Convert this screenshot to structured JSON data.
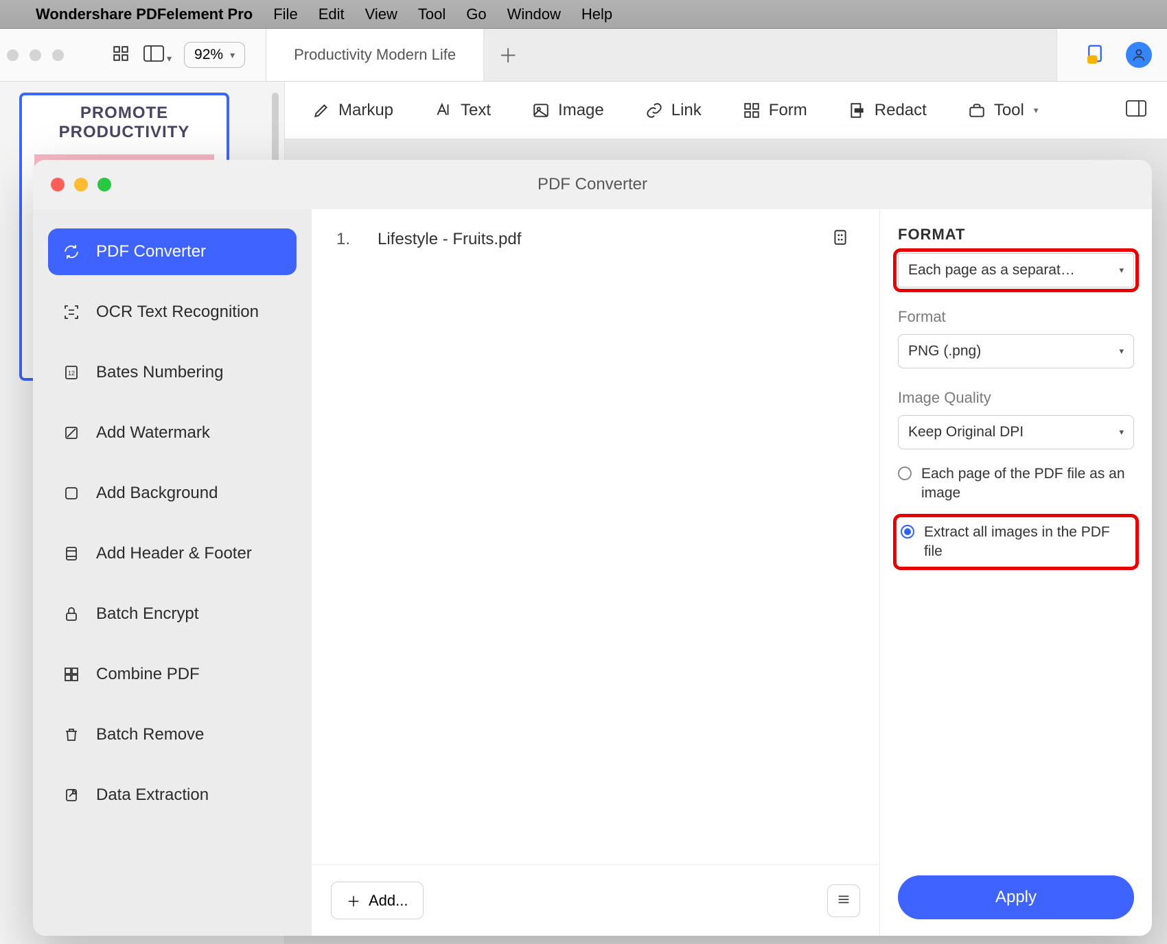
{
  "menubar": {
    "app_name": "Wondershare PDFelement Pro",
    "items": [
      "File",
      "Edit",
      "View",
      "Tool",
      "Go",
      "Window",
      "Help"
    ]
  },
  "chrome": {
    "zoom": "92%",
    "tab_title": "Productivity Modern Life"
  },
  "toolbar": {
    "items": [
      "Markup",
      "Text",
      "Image",
      "Link",
      "Form",
      "Redact",
      "Tool"
    ]
  },
  "thumbnail": {
    "title": "PROMOTE PRODUCTIVITY"
  },
  "modal": {
    "title": "PDF Converter",
    "sidebar": [
      "PDF Converter",
      "OCR Text Recognition",
      "Bates Numbering",
      "Add Watermark",
      "Add Background",
      "Add Header & Footer",
      "Batch Encrypt",
      "Combine PDF",
      "Batch Remove",
      "Data Extraction"
    ],
    "file_list": [
      {
        "num": "1.",
        "name": "Lifestyle - Fruits.pdf"
      }
    ],
    "add_label": "Add...",
    "right": {
      "format_heading": "FORMAT",
      "mode_value": "Each page as a separat…",
      "format_label": "Format",
      "format_value": "PNG (.png)",
      "quality_label": "Image Quality",
      "quality_value": "Keep Original DPI",
      "radio1": "Each page of the PDF file as an image",
      "radio2": "Extract all images in the PDF file",
      "apply": "Apply"
    }
  }
}
